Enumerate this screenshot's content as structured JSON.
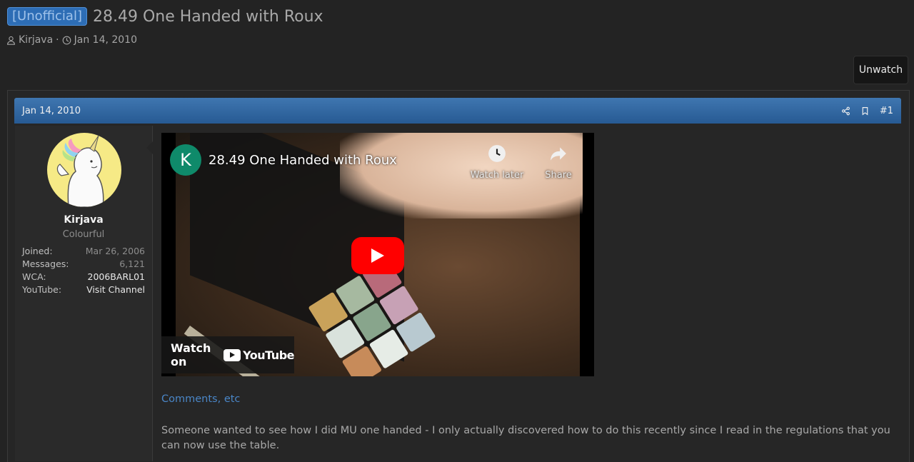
{
  "thread": {
    "prefix": "[Unofficial]",
    "title": "28.49 One Handed with Roux",
    "author": "Kirjava",
    "separator": "·",
    "date": "Jan 14, 2010"
  },
  "actions": {
    "unwatch_label": "Unwatch"
  },
  "post": {
    "date": "Jan 14, 2010",
    "number": "#1",
    "user": {
      "name": "Kirjava",
      "title": "Colourful",
      "stats": [
        {
          "label": "Joined:",
          "value": "Mar 26, 2006"
        },
        {
          "label": "Messages:",
          "value": "6,121"
        },
        {
          "label": "WCA:",
          "value": "2006BARL01"
        },
        {
          "label": "YouTube:",
          "value": "Visit Channel"
        }
      ]
    },
    "video": {
      "channel_initial": "K",
      "title": "28.49 One Handed with Roux",
      "watch_later_label": "Watch later",
      "share_label": "Share",
      "watch_on_label": "Watch on",
      "youtube_label": "YouTube"
    },
    "comments_link": "Comments, etc",
    "body": "Someone wanted to see how I did MU one handed - I only actually discovered how to do this recently since I read in the regulations that you can now use the table."
  },
  "colors": {
    "accent": "#2d6db5",
    "header_gradient_top": "#3f76b0",
    "header_gradient_bottom": "#275a93",
    "link": "#4a86c7",
    "play_button": "#ff0000"
  },
  "icons": [
    "user-icon",
    "clock-icon",
    "share-icon",
    "bookmark-icon",
    "watch-later-icon",
    "share-arrow-icon",
    "play-icon",
    "youtube-logo-icon"
  ]
}
